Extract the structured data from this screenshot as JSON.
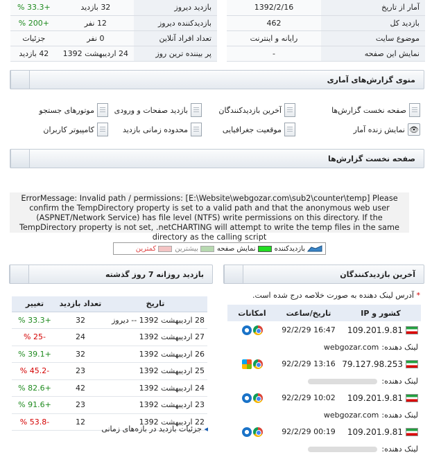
{
  "summary_right": [
    {
      "label": "آمار از تاریخ",
      "value": "1392/2/16"
    },
    {
      "label": "بازدید کل",
      "value": "462"
    },
    {
      "label": "موضوع سایت",
      "value": "رایانه و اینترنت"
    },
    {
      "label": "نمایش این صفحه",
      "value": "-"
    }
  ],
  "summary_left": [
    {
      "label": "بازدید دیروز",
      "value": "32 بازدید",
      "extra": "+33.3 %"
    },
    {
      "label": "بازدیدکننده دیروز",
      "value": "12 نفر",
      "extra": "+200 %"
    },
    {
      "label": "تعداد افراد آنلاین",
      "value": "0 نفر",
      "extra": "جزئیات"
    },
    {
      "label": "پر بیننده ترین روز",
      "value": "24 اردیبهشت 1392",
      "extra": "42 بازدید"
    }
  ],
  "menu_title": "منوی گزارش‌های آماری",
  "menu_items": [
    "صفحه نخست گزارش‌ها",
    "آخرین بازدیدکنندگان",
    "بازدید صفحات و ورودی",
    "موتورهای جستجو",
    "نمایش زنده آمار",
    "موقعیت جغرافیایی",
    "محدوده زمانی بازدید",
    "کامپیوتر کاربران"
  ],
  "home_title": "صفحه نخست گزارش‌ها",
  "error_message": "ErrorMessage: Invalid path / permissions: [E:\\Website\\webgozar.com\\sub2\\counter\\temp] Please confirm the TempDirectory property is set to a valid path and that the anonymous web user (ASPNET/Network Service) has file level (NTFS) write permissions on this directory. If the TempDirectory property is not set, .netCHARTING will attempt to write the temp files in the same directory as the calling script",
  "legend": {
    "visitors": "بازدیدکننده",
    "pageviews": "نمایش صفحه",
    "most": "بیشترین",
    "least": "کمترین"
  },
  "colors": {
    "visitors": "#3b86c8",
    "pageviews": "#22dd22",
    "most": "#b7d9b0",
    "least": "#f4c4c4",
    "increase": "#1e8a1e",
    "decrease": "#d40000"
  },
  "daily": {
    "title": "بازدید روزانه 7 روز گذشته",
    "headers": {
      "date": "تاریخ",
      "count": "تعداد بازدید",
      "change": "تغییر"
    },
    "rows": [
      {
        "date": "28 اردیبهشت 1392 -- دیروز",
        "count": "32",
        "change": "+33.3 %",
        "trend": "up"
      },
      {
        "date": "27 اردیبهشت 1392",
        "count": "24",
        "change": "-25 %",
        "trend": "down"
      },
      {
        "date": "26 اردیبهشت 1392",
        "count": "32",
        "change": "+39.1 %",
        "trend": "up"
      },
      {
        "date": "25 اردیبهشت 1392",
        "count": "23",
        "change": "-45.2 %",
        "trend": "down"
      },
      {
        "date": "24 اردیبهشت 1392",
        "count": "42",
        "change": "+82.6 %",
        "trend": "up"
      },
      {
        "date": "23 اردیبهشت 1392",
        "count": "23",
        "change": "+91.6 %",
        "trend": "up"
      },
      {
        "date": "22 اردیبهشت 1392",
        "count": "12",
        "change": "-53.8 %",
        "trend": "down"
      }
    ],
    "details_link": "جزئیات بازدید در بازه‌های زمانی"
  },
  "visitors": {
    "title": "آخرین بازدیدکنندگان",
    "note_star": "*",
    "note": "آدرس لینک دهنده به صورت خلاصه درج شده است.",
    "headers": {
      "ip": "کشور و IP",
      "datetime": "تاریخ/ساعت",
      "features": "امکانات"
    },
    "referrer_label": "لینک دهنده:",
    "rows": [
      {
        "ip": "109.201.9.81",
        "datetime": "16:47 92/2/29",
        "referrer": "webgozar.com",
        "os": "win"
      },
      {
        "ip": "79.127.98.253",
        "datetime": "13:16 92/2/29",
        "referrer": "",
        "os": "win-old"
      },
      {
        "ip": "109.201.9.81",
        "datetime": "10:02 92/2/29",
        "referrer": "webgozar.com",
        "os": "win"
      },
      {
        "ip": "109.201.9.81",
        "datetime": "00:19 92/2/29",
        "referrer": "",
        "os": "win"
      }
    ]
  }
}
